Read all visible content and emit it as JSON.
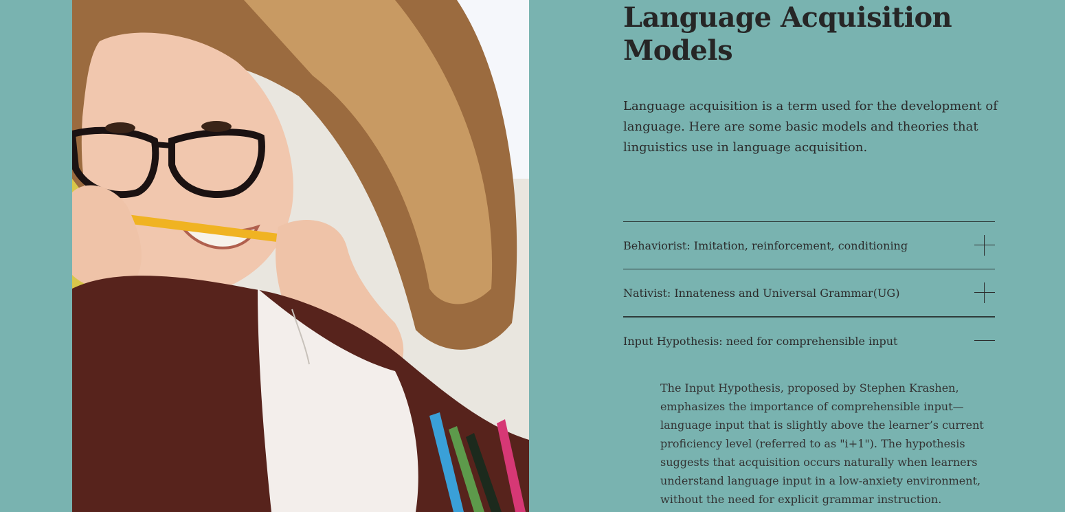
{
  "hero": {
    "title_line1": "Language Acquisition",
    "title_line2": "Models",
    "intro": "Language acquisition is a term used for the development of language. Here are some basic models and theories that linguistics use in language acquisition."
  },
  "accordion": {
    "items": [
      {
        "label": "Behaviorist: Imitation, reinforcement, conditioning",
        "expanded": false
      },
      {
        "label": "Nativist: Innateness and Universal Grammar(UG)",
        "expanded": false
      },
      {
        "label": "Input Hypothesis: need for comprehensible input",
        "expanded": true,
        "body": "The Input Hypothesis, proposed by Stephen Krashen, emphasizes the importance of comprehensible input—language input that is slightly above the learner’s current proficiency level (referred to as \"i+1\"). The hypothesis suggests that acquisition occurs naturally when learners understand language input in a low-anxiety environment, without the need for explicit grammar instruction."
      }
    ]
  },
  "colors": {
    "background": "#79b3b0",
    "text": "#2a2a2a",
    "divider": "#2e3b3a"
  },
  "icons": {
    "collapsed": "plus-icon",
    "expanded": "minus-icon"
  }
}
